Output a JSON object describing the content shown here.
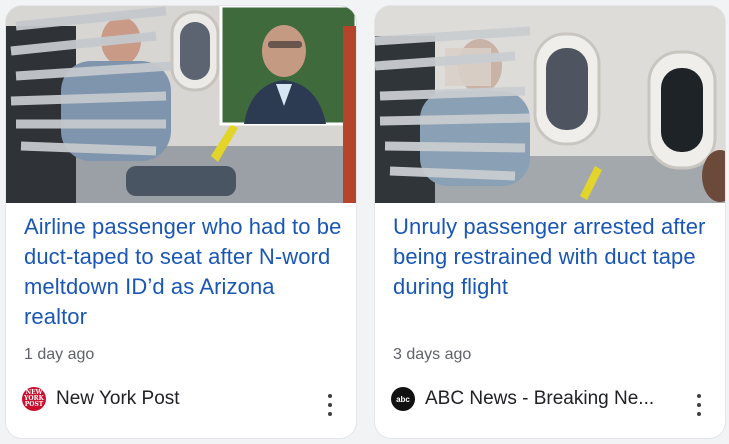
{
  "cards": [
    {
      "headline": "Airline passenger who had to be duct-taped to seat after N-word meltdown ID’d as Arizona realtor",
      "age": "1 day ago",
      "source": "New York Post",
      "favicon_text": "NEW YORK POST",
      "favicon_icon": "new-york-post-logo",
      "image_icon": "news-photo"
    },
    {
      "headline": "Unruly passenger arrested after being restrained with duct tape during flight",
      "age": "3 days ago",
      "source": "ABC News - Breaking Ne...",
      "favicon_text": "abc",
      "favicon_icon": "abc-news-logo",
      "image_icon": "news-photo"
    }
  ],
  "colors": {
    "headline": "#1a57b5",
    "meta_text": "#5f6368",
    "source_text": "#202124",
    "background": "#f1f3f4",
    "card": "#ffffff"
  }
}
